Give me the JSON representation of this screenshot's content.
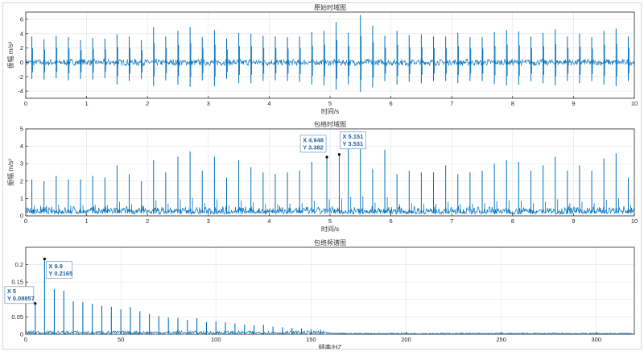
{
  "charts": [
    {
      "title": "原始时域图",
      "xlabel": "时间/s",
      "ylabel": "振幅 m/s²",
      "xlim": [
        0,
        10
      ],
      "ylim": [
        -5,
        7
      ],
      "xticks": [
        0,
        1,
        2,
        3,
        4,
        5,
        6,
        7,
        8,
        9,
        10
      ],
      "yticks": [
        -4,
        -2,
        0,
        2,
        4,
        6
      ],
      "xtick_labels": [
        "0",
        "1",
        "2",
        "3",
        "4",
        "5",
        "6",
        "7",
        "8",
        "9",
        "10"
      ],
      "ytick_labels": [
        "-4",
        "-2",
        "0",
        "2",
        "4",
        "6"
      ],
      "datatips": []
    },
    {
      "title": "包络时域图",
      "xlabel": "时间/s",
      "ylabel": "振幅 m/s²",
      "xlim": [
        0,
        10
      ],
      "ylim": [
        0,
        5
      ],
      "xticks": [
        0,
        1,
        2,
        3,
        4,
        5,
        6,
        7,
        8,
        9,
        10
      ],
      "yticks": [
        0,
        1,
        2,
        3,
        4,
        5
      ],
      "xtick_labels": [
        "0",
        "1",
        "2",
        "3",
        "4",
        "5",
        "6",
        "7",
        "8",
        "9",
        "10"
      ],
      "ytick_labels": [
        "0",
        "1",
        "2",
        "3",
        "4",
        "5"
      ],
      "datatips": [
        {
          "x": 4.948,
          "y": 3.382,
          "x_label": "X 4.948",
          "y_label": "Y 3.382"
        },
        {
          "x": 5.151,
          "y": 3.531,
          "x_label": "X 5.151",
          "y_label": "Y 3.531"
        }
      ]
    },
    {
      "title": "包络频谱图",
      "xlabel": "频率/HZ",
      "ylabel": "",
      "xlim": [
        0,
        320
      ],
      "ylim": [
        0,
        0.25
      ],
      "xticks": [
        0,
        50,
        100,
        150,
        200,
        250,
        300
      ],
      "yticks": [
        0,
        0.05,
        0.1,
        0.15,
        0.2
      ],
      "xtick_labels": [
        "0",
        "50",
        "100",
        "150",
        "200",
        "250",
        "300"
      ],
      "ytick_labels": [
        "0",
        "0.05",
        "0.1",
        "0.15",
        "0.2"
      ],
      "datatips": [
        {
          "x": 5,
          "y": 0.08857,
          "x_label": "X 5",
          "y_label": "Y 0.08857"
        },
        {
          "x": 9.9,
          "y": 0.2165,
          "x_label": "X 9.9",
          "y_label": "Y 0.2165"
        }
      ]
    }
  ],
  "chart_data": [
    {
      "type": "line",
      "title": "原始时域图",
      "xlabel": "时间/s",
      "ylabel": "振幅 m/s²",
      "xlim": [
        0,
        10
      ],
      "ylim": [
        -5,
        7
      ],
      "grid": true,
      "impulses": {
        "x": [
          0.1,
          0.3,
          0.5,
          0.7,
          0.9,
          1.1,
          1.3,
          1.5,
          1.7,
          1.9,
          2.1,
          2.3,
          2.5,
          2.7,
          2.9,
          3.1,
          3.3,
          3.5,
          3.7,
          3.9,
          4.1,
          4.3,
          4.5,
          4.7,
          4.9,
          5.1,
          5.3,
          5.5,
          5.7,
          5.9,
          6.1,
          6.3,
          6.5,
          6.7,
          6.9,
          7.1,
          7.3,
          7.5,
          7.7,
          7.9,
          8.1,
          8.3,
          8.5,
          8.7,
          8.9,
          9.1,
          9.3,
          9.5,
          9.7,
          9.9
        ],
        "y_max": [
          3.6,
          3.2,
          3.7,
          3.5,
          3.1,
          3.4,
          3.3,
          3.9,
          3.6,
          3.1,
          4.9,
          3.6,
          4.4,
          4.9,
          3.5,
          4.5,
          3.3,
          4.1,
          4.0,
          3.7,
          3.6,
          3.5,
          3.6,
          4.2,
          4.4,
          5.6,
          4.1,
          6.6,
          5.1,
          3.7,
          4.4,
          3.8,
          3.9,
          3.6,
          3.6,
          4.1,
          3.5,
          3.5,
          4.2,
          4.5,
          4.3,
          3.6,
          4.1,
          4.6,
          3.6,
          4.0,
          3.5,
          4.4,
          4.7,
          3.6
        ],
        "y_min": [
          -2.3,
          -2.4,
          -2.2,
          -2.5,
          -2.3,
          -2.4,
          -2.2,
          -3.1,
          -2.6,
          -2.3,
          -3.3,
          -2.5,
          -3.1,
          -3.4,
          -2.5,
          -3.3,
          -2.3,
          -2.9,
          -2.9,
          -2.6,
          -2.5,
          -2.6,
          -2.7,
          -3.1,
          -3.2,
          -3.8,
          -3.1,
          -4.1,
          -3.5,
          -2.6,
          -3.1,
          -2.7,
          -2.9,
          -2.6,
          -2.6,
          -2.9,
          -2.6,
          -2.6,
          -3.0,
          -3.2,
          -3.1,
          -2.6,
          -2.9,
          -3.2,
          -2.6,
          -2.9,
          -2.6,
          -3.1,
          -3.3,
          -2.6
        ]
      },
      "baseline_band": [
        -0.5,
        0.5
      ]
    },
    {
      "type": "line",
      "title": "包络时域图",
      "xlabel": "时间/s",
      "ylabel": "振幅 m/s²",
      "xlim": [
        0,
        10
      ],
      "ylim": [
        0,
        5
      ],
      "grid": true,
      "impulses": {
        "x": [
          0.1,
          0.3,
          0.5,
          0.7,
          0.9,
          1.1,
          1.3,
          1.5,
          1.7,
          1.9,
          2.1,
          2.3,
          2.5,
          2.7,
          2.9,
          3.1,
          3.3,
          3.5,
          3.7,
          3.9,
          4.1,
          4.3,
          4.5,
          4.7,
          4.948,
          5.151,
          5.3,
          5.5,
          5.7,
          5.9,
          6.1,
          6.3,
          6.5,
          6.7,
          6.9,
          7.1,
          7.3,
          7.5,
          7.7,
          7.9,
          8.1,
          8.3,
          8.5,
          8.7,
          8.9,
          9.1,
          9.3,
          9.5,
          9.7,
          9.9
        ],
        "y": [
          2.1,
          2.0,
          2.3,
          2.1,
          2.1,
          2.3,
          2.2,
          2.9,
          2.4,
          2.0,
          3.2,
          2.5,
          3.4,
          3.7,
          2.6,
          3.4,
          2.2,
          3.2,
          2.8,
          2.5,
          2.4,
          2.5,
          2.6,
          3.1,
          3.382,
          3.531,
          3.9,
          4.0,
          2.7,
          3.8,
          2.4,
          2.6,
          2.5,
          2.5,
          2.9,
          2.4,
          2.5,
          2.6,
          3.0,
          3.2,
          3.1,
          2.6,
          2.9,
          3.4,
          2.6,
          2.9,
          2.6,
          3.3,
          3.6,
          2.2
        ]
      },
      "baseline_band": [
        0.1,
        0.6
      ]
    },
    {
      "type": "line",
      "title": "包络频谱图",
      "xlabel": "频率/HZ",
      "ylabel": "",
      "xlim": [
        0,
        320
      ],
      "ylim": [
        0,
        0.25
      ],
      "grid": true,
      "peaks": {
        "x": [
          5,
          9.9,
          15,
          20,
          25,
          30,
          35,
          40,
          45,
          50,
          55,
          60,
          65,
          70,
          75,
          80,
          85,
          90,
          95,
          100,
          105,
          110,
          115,
          120,
          125,
          130,
          135,
          140,
          145,
          150,
          155
        ],
        "y": [
          0.08857,
          0.2165,
          0.13,
          0.125,
          0.095,
          0.092,
          0.088,
          0.082,
          0.079,
          0.072,
          0.078,
          0.066,
          0.058,
          0.052,
          0.048,
          0.047,
          0.041,
          0.046,
          0.035,
          0.037,
          0.034,
          0.031,
          0.028,
          0.026,
          0.027,
          0.022,
          0.02,
          0.018,
          0.017,
          0.015,
          0.013
        ]
      },
      "noise_floor": 0.006
    }
  ],
  "colors": {
    "line": "#0072bd",
    "grid": "#e6e6e6",
    "axis": "#262626",
    "datatip_border": "#7fa9d1",
    "datatip_fill": "#ffffff",
    "datatip_text": "#1f5f99"
  }
}
